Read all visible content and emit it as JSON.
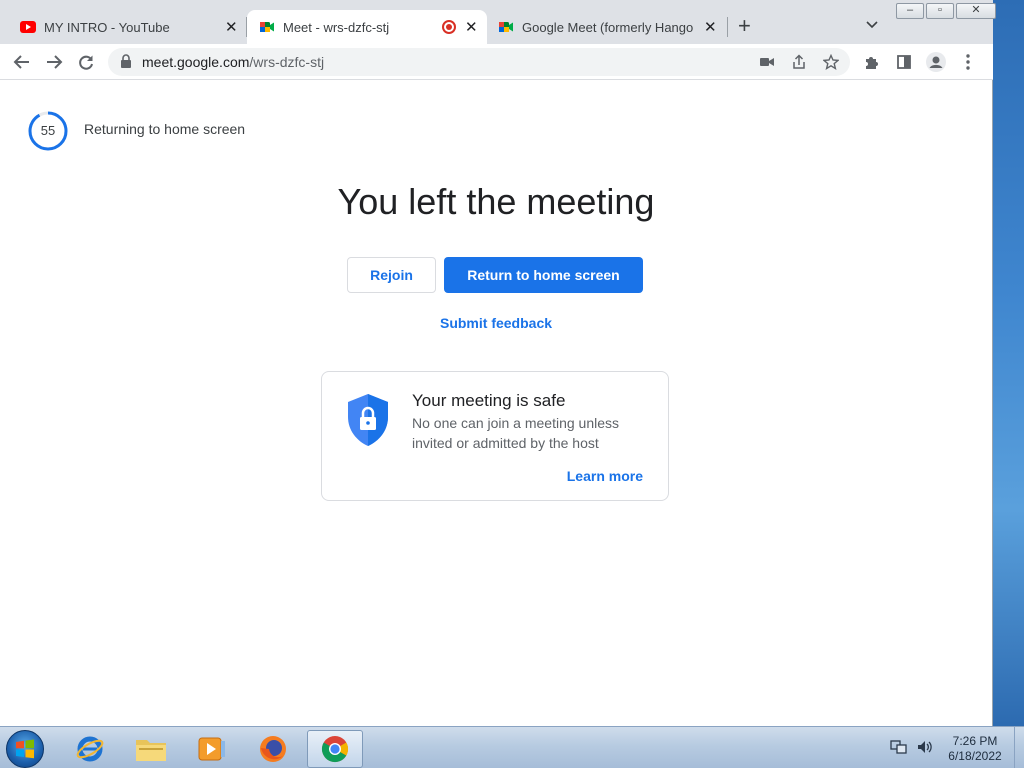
{
  "tabs": [
    {
      "title": "MY INTRO - YouTube",
      "favicon": "youtube-icon",
      "active": false
    },
    {
      "title": "Meet - wrs-dzfc-stj",
      "favicon": "google-meet-icon",
      "active": true,
      "recording": true
    },
    {
      "title": "Google Meet (formerly Hangouts",
      "favicon": "google-meet-icon",
      "active": false
    }
  ],
  "toolbar": {
    "url_host": "meet.google.com",
    "url_path": "/wrs-dzfc-stj"
  },
  "page": {
    "countdown": "55",
    "countdown_fraction": 0.92,
    "countdown_label": "Returning to home screen",
    "heading": "You left the meeting",
    "rejoin_label": "Rejoin",
    "return_label": "Return to home screen",
    "feedback_label": "Submit feedback",
    "safe_title": "Your meeting is safe",
    "safe_body": "No one can join a meeting unless invited or admitted by the host",
    "learn_more": "Learn more"
  },
  "taskbar": {
    "apps": [
      "internet-explorer-icon",
      "file-explorer-icon",
      "media-player-icon",
      "firefox-icon",
      "chrome-icon"
    ],
    "time": "7:26 PM",
    "date": "6/18/2022"
  },
  "colors": {
    "accent": "#1a73e8",
    "tabstrip": "#dee1e6"
  }
}
